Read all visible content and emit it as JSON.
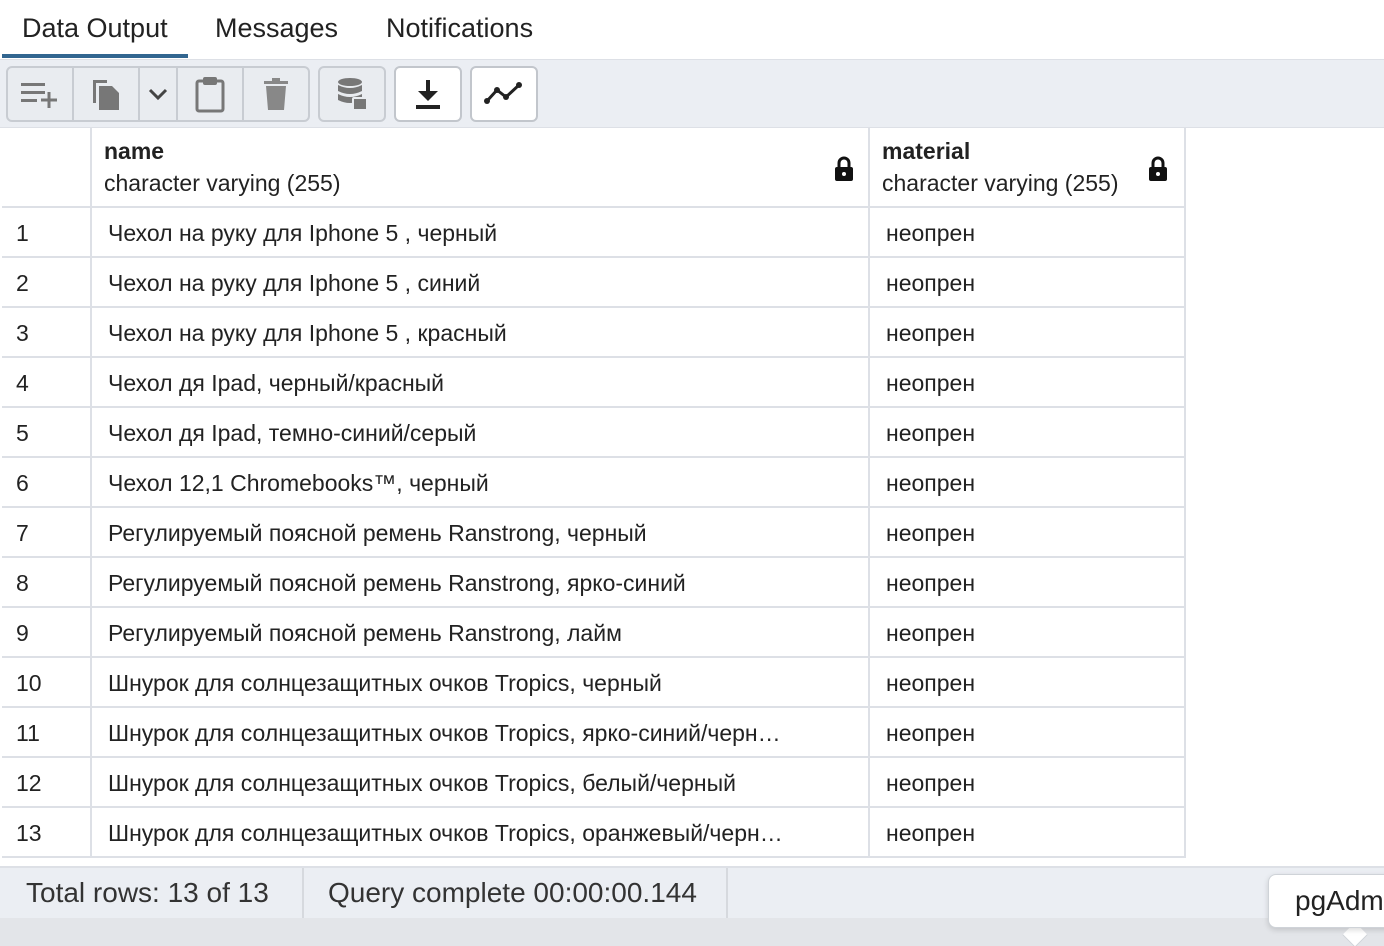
{
  "tabs": [
    {
      "label": "Data Output",
      "active": true
    },
    {
      "label": "Messages",
      "active": false
    },
    {
      "label": "Notifications",
      "active": false
    }
  ],
  "toolbar": {
    "buttons": [
      {
        "icon": "add-row-icon"
      },
      {
        "icon": "copy-icon"
      },
      {
        "icon": "chevron-down-icon"
      },
      {
        "icon": "paste-icon"
      },
      {
        "icon": "delete-icon"
      },
      {
        "icon": "save-data-icon"
      },
      {
        "icon": "download-icon"
      },
      {
        "icon": "graph-visualiser-icon"
      }
    ]
  },
  "columns": [
    {
      "name": "name",
      "type": "character varying (255)",
      "icon": "lock-icon"
    },
    {
      "name": "material",
      "type": "character varying (255)",
      "icon": "lock-icon"
    }
  ],
  "rows": [
    {
      "n": "1",
      "name": "Чехол на руку для Iphone 5 , черный",
      "material": "неопрен"
    },
    {
      "n": "2",
      "name": "Чехол на руку для Iphone 5 , синий",
      "material": "неопрен"
    },
    {
      "n": "3",
      "name": "Чехол на руку для Iphone 5 , красный",
      "material": "неопрен"
    },
    {
      "n": "4",
      "name": "Чехол дя Ipad, черный/красный",
      "material": "неопрен"
    },
    {
      "n": "5",
      "name": "Чехол дя Ipad, темно-синий/серый",
      "material": "неопрен"
    },
    {
      "n": "6",
      "name": "Чехол 12,1 Chromebooks™, черный",
      "material": "неопрен"
    },
    {
      "n": "7",
      "name": "Регулируемый поясной ремень Ranstrong, черный",
      "material": "неопрен"
    },
    {
      "n": "8",
      "name": "Регулируемый поясной ремень Ranstrong, ярко-синий",
      "material": "неопрен"
    },
    {
      "n": "9",
      "name": "Регулируемый поясной ремень Ranstrong, лайм",
      "material": "неопрен"
    },
    {
      "n": "10",
      "name": "Шнурок для солнцезащитных очков Tropics, черный",
      "material": "неопрен"
    },
    {
      "n": "11",
      "name": "Шнурок для солнцезащитных очков Tropics, ярко-синий/черн…",
      "material": "неопрен"
    },
    {
      "n": "12",
      "name": "Шнурок для солнцезащитных очков Tropics, белый/черный",
      "material": "неопрен"
    },
    {
      "n": "13",
      "name": "Шнурок для солнцезащитных очков Tropics, оранжевый/черн…",
      "material": "неопрен"
    }
  ],
  "status": {
    "total_rows": "Total rows: 13 of 13",
    "query": "Query complete 00:00:00.144"
  },
  "toast": {
    "text": "pgAdm"
  },
  "colors": {
    "accent": "#326690",
    "toolbar_bg": "#ebeef3",
    "border": "#dde0e6"
  }
}
